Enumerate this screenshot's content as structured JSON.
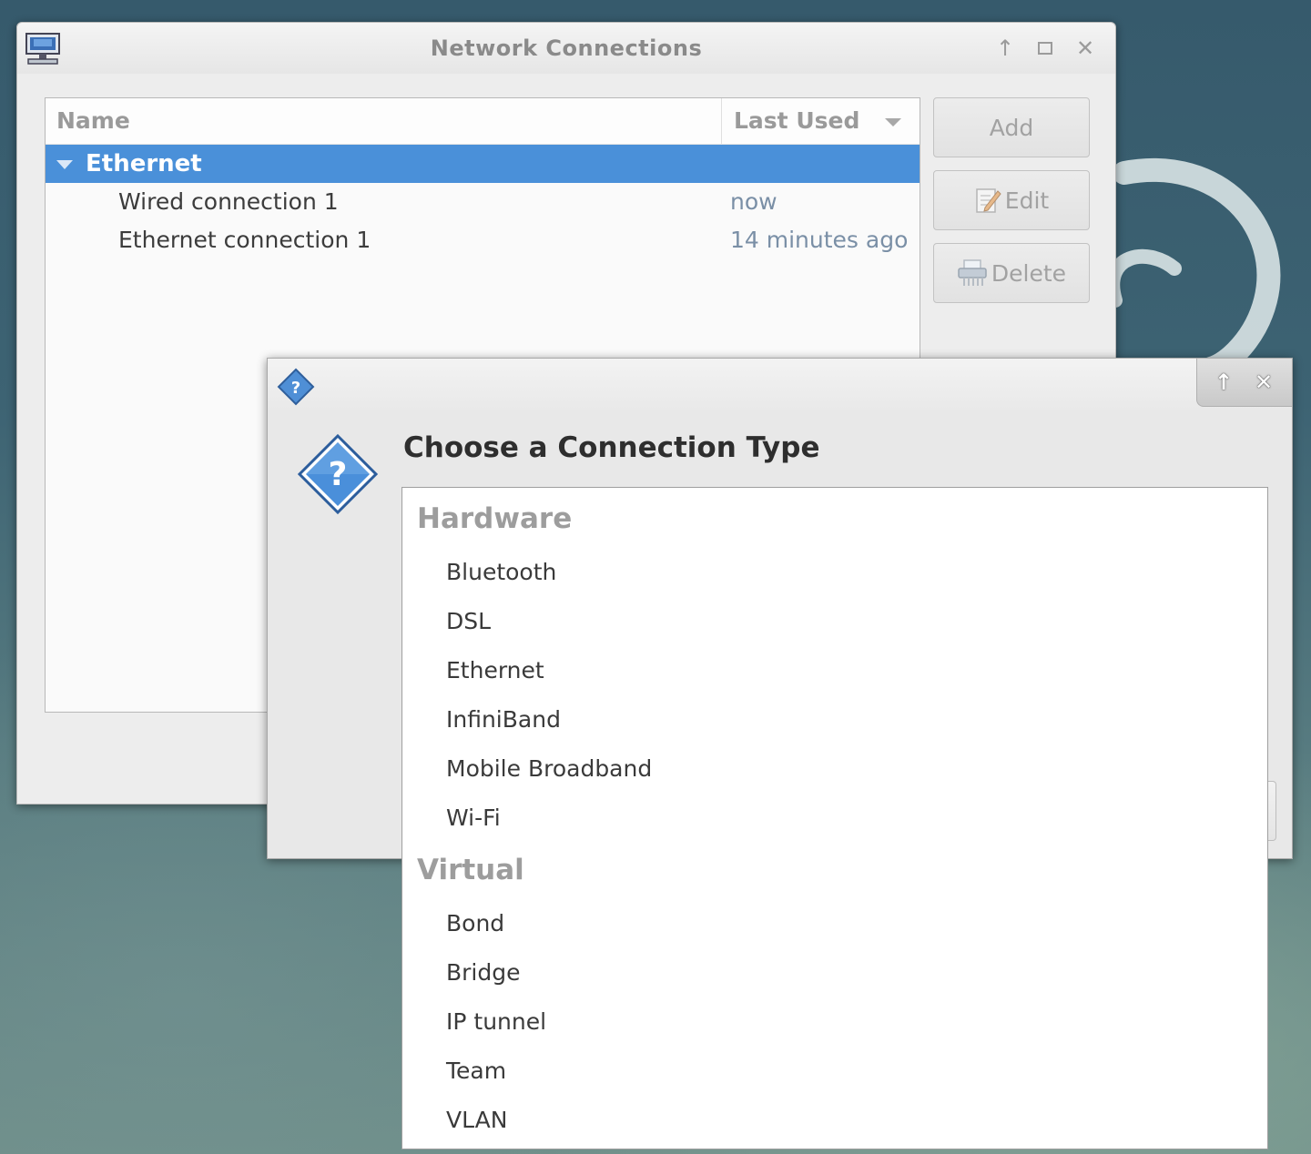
{
  "main_window": {
    "title": "Network Connections",
    "columns": {
      "name": "Name",
      "last_used": "Last Used"
    },
    "group": "Ethernet",
    "connections": [
      {
        "name": "Wired connection 1",
        "last_used": "now"
      },
      {
        "name": "Ethernet connection 1",
        "last_used": "14 minutes ago"
      }
    ],
    "buttons": {
      "add": "Add",
      "edit": "Edit",
      "delete": "Delete"
    }
  },
  "dialog": {
    "heading": "Choose a Connection Type",
    "categories": [
      {
        "label": "Hardware",
        "items": [
          "Bluetooth",
          "DSL",
          "Ethernet",
          "InfiniBand",
          "Mobile Broadband",
          "Wi-Fi"
        ]
      },
      {
        "label": "Virtual",
        "items": [
          "Bond",
          "Bridge",
          "IP tunnel",
          "Team",
          "VLAN"
        ]
      }
    ]
  },
  "colors": {
    "selection": "#4a90d9",
    "time_text": "#7a8fa6",
    "category_text": "#9d9d9d"
  },
  "icons": [
    "network-computer-icon",
    "move-up-icon",
    "maximize-icon",
    "close-icon",
    "sort-descending-icon",
    "expander-down-icon",
    "edit-pencil-icon",
    "shredder-delete-icon",
    "question-dialog-icon"
  ]
}
